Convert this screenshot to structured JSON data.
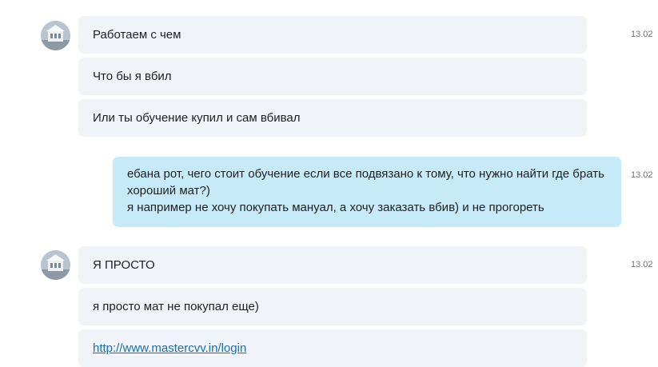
{
  "messages": {
    "group1": {
      "time": "13.02",
      "m1": "Работаем с чем",
      "m2": "Что бы я вбил",
      "m3": "Или ты обучение купил и сам вбивал"
    },
    "outgoing": {
      "time": "13.02",
      "line1": "ебана рот, чего стоит обучение если все подвязано к тому, что нужно найти где брать",
      "line2": "хороший мат?)",
      "line3": "я например не хочу покупать мануал, а хочу заказать вбив) и не прогореть"
    },
    "group2": {
      "time": "13.02",
      "m1": "Я ПРОСТО",
      "m2": "я просто мат не покупал еще)",
      "m3_link": "http://www.mastercvv.in/login"
    }
  },
  "colors": {
    "incoming_bubble": "#f0f3f8",
    "outgoing_bubble": "#c7eaf9",
    "link": "#1b6fa8",
    "timestamp": "#6d7278"
  },
  "icons": {
    "avatar": "contact-avatar-icon"
  }
}
